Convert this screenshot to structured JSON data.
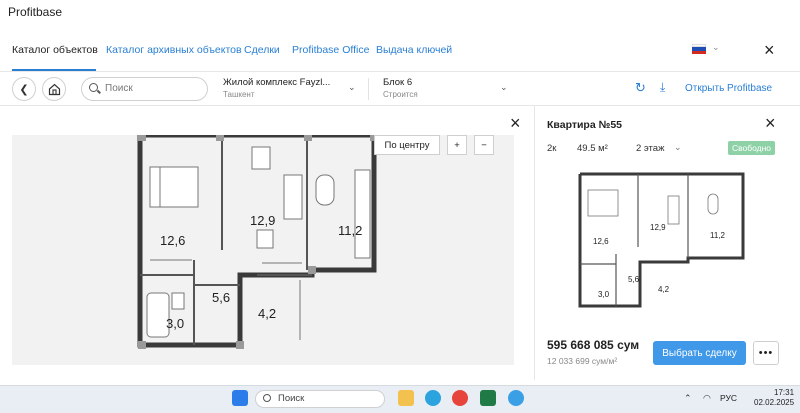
{
  "window": {
    "title": "Profitbase"
  },
  "nav": {
    "tabs": [
      {
        "label": "Каталог объектов",
        "active": true
      },
      {
        "label": "Каталог архивных объектов"
      },
      {
        "label": "Сделки"
      },
      {
        "label": "Profitbase Office"
      },
      {
        "label": "Выдача ключей"
      }
    ],
    "close_icon": "×"
  },
  "toolbar": {
    "search_placeholder": "Поиск",
    "complex": {
      "name": "Жилой комплекс Fayzl...",
      "city": "Ташкент"
    },
    "block": {
      "name": "Блок 6",
      "status": "Строится"
    },
    "open_label": "Открыть Profitbase"
  },
  "plan": {
    "center_label": "По центру",
    "zoom_in": "+",
    "zoom_out": "−",
    "rooms": [
      "12,6",
      "12,9",
      "11,2",
      "5,6",
      "4,2",
      "3,0"
    ]
  },
  "apartment": {
    "title": "Квартира №55",
    "rooms": "2к",
    "area": "49.5 м²",
    "floor": "2 этаж",
    "status": "Свободно",
    "price": "595 668 085 сум",
    "price_per_m2": "12 033 699 сум/м²",
    "choose_label": "Выбрать сделку",
    "more_label": "•••"
  },
  "taskbar": {
    "search_placeholder": "Поиск",
    "lang": "РУС",
    "time": "17:31",
    "date": "02.02.2025"
  },
  "colors": {
    "accent": "#2a7fd4",
    "status_free": "#8ed1a6",
    "button": "#3f98e8"
  }
}
